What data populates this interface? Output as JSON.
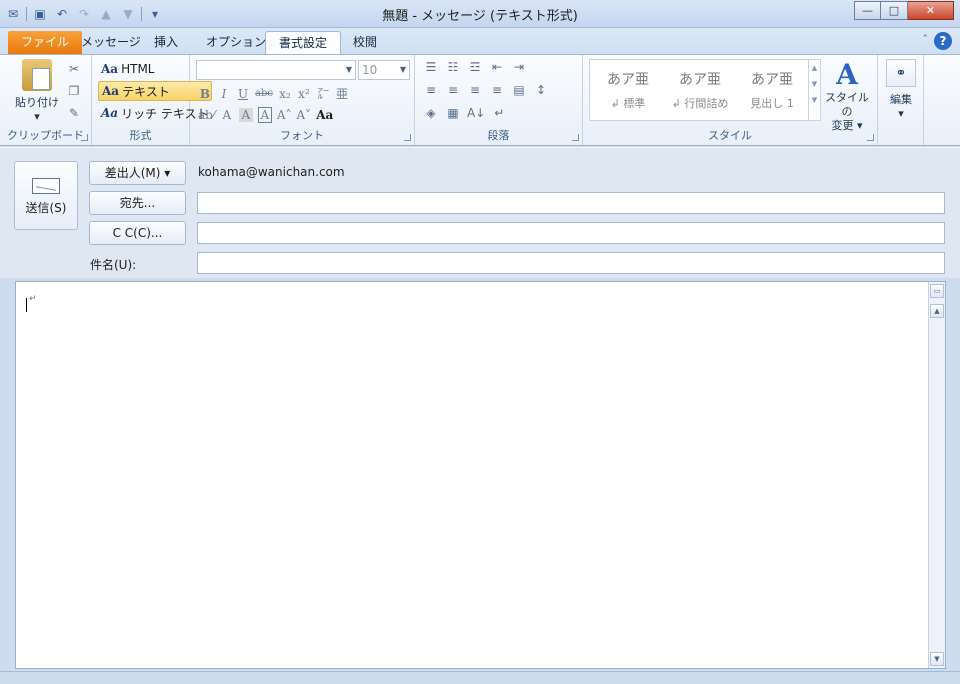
{
  "window": {
    "title": "無題 - メッセージ (テキスト形式)",
    "minimize_glyph": "—",
    "maximize_glyph": "□",
    "close_glyph": "✕"
  },
  "qat": {
    "icons": [
      "outlook-icon",
      "save-icon",
      "undo-icon",
      "redo-icon",
      "up-arrow-icon",
      "down-arrow-icon",
      "customize-icon"
    ]
  },
  "tabs": [
    {
      "label": "ファイル"
    },
    {
      "label": "メッセージ"
    },
    {
      "label": "挿入"
    },
    {
      "label": "オプション"
    },
    {
      "label": "書式設定"
    },
    {
      "label": "校閲"
    }
  ],
  "help_glyph": "?",
  "collapse_glyph": "ˆ",
  "ribbon": {
    "clipboard": {
      "label": "クリップボード",
      "paste": "貼り付け",
      "paste_arrow": "▾"
    },
    "format": {
      "label": "形式",
      "options": [
        {
          "aa": "Aa",
          "text": "HTML"
        },
        {
          "aa": "Aa",
          "text": "テキスト"
        },
        {
          "aa": "Aa",
          "text": "リッチ テキスト"
        }
      ]
    },
    "font": {
      "label": "フォント",
      "font_name": "",
      "font_size": "10",
      "row1": [
        "B",
        "I",
        "U",
        "abc",
        "x₂",
        "x²",
        "㌃",
        "亜"
      ],
      "row2": [
        "ab⁄",
        "A",
        "A",
        "A",
        "A˄",
        "A˅",
        "Aa"
      ]
    },
    "paragraph": {
      "label": "段落",
      "row1": [
        "☰",
        "☷",
        "☲",
        "⇤",
        "⇥"
      ],
      "row2": [
        "≡",
        "≡",
        "≡",
        "≡",
        "▤",
        "↕"
      ],
      "row3": [
        "◈",
        "▦",
        "A↓",
        "↵"
      ]
    },
    "styles": {
      "label": "スタイル",
      "items": [
        {
          "big": "あア亜",
          "sub": "↲ 標準"
        },
        {
          "big": "あア亜",
          "sub": "↲ 行間詰め"
        },
        {
          "big": "あア亜",
          "sub": "見出し 1"
        }
      ],
      "change_big": "A",
      "change_line1": "スタイルの",
      "change_line2": "変更 ▾"
    },
    "editing": {
      "label": "編集",
      "arrow": "▾"
    }
  },
  "header": {
    "send": "送信(S)",
    "from_button": "差出人(M) ▾",
    "from_value": "kohama@wanichan.com",
    "to_button": "宛先...",
    "to_value": "",
    "cc_button": "C C(C)...",
    "cc_value": "",
    "subject_label": "件名(U):",
    "subject_value": ""
  },
  "body": {
    "text": "",
    "para_mark": "↵"
  },
  "scroll": {
    "up": "▲",
    "down": "▼",
    "ruler": "▭"
  }
}
